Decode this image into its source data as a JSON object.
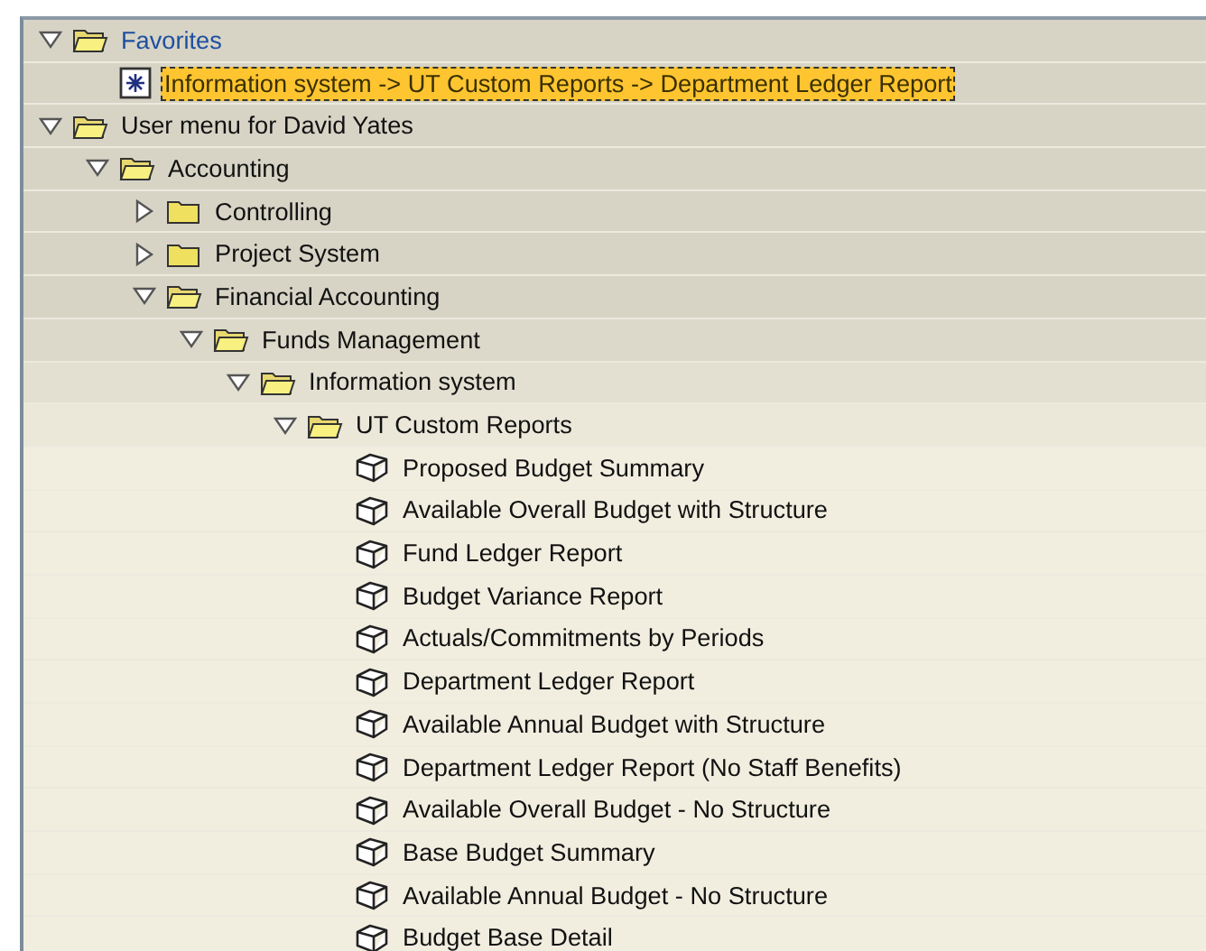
{
  "tree": [
    {
      "kind": "folder",
      "label": "Favorites",
      "expanded": true,
      "selected": false,
      "children": [
        {
          "kind": "favorite",
          "label": "Information system -> UT Custom Reports -> Department Ledger Report",
          "selected": true
        }
      ]
    },
    {
      "kind": "folder",
      "label": "User menu for David Yates",
      "expanded": true,
      "selected": false,
      "children": [
        {
          "kind": "folder",
          "label": "Accounting",
          "expanded": true,
          "selected": false,
          "children": [
            {
              "kind": "folder",
              "label": "Controlling",
              "expanded": false,
              "selected": false
            },
            {
              "kind": "folder",
              "label": "Project System",
              "expanded": false,
              "selected": false
            },
            {
              "kind": "folder",
              "label": "Financial Accounting",
              "expanded": true,
              "selected": false,
              "children": [
                {
                  "kind": "folder",
                  "label": "Funds Management",
                  "expanded": true,
                  "selected": false,
                  "children": [
                    {
                      "kind": "folder",
                      "label": "Information system",
                      "expanded": true,
                      "selected": false,
                      "children": [
                        {
                          "kind": "folder",
                          "label": "UT Custom Reports",
                          "expanded": true,
                          "selected": false,
                          "children": [
                            {
                              "kind": "report",
                              "label": "Proposed Budget Summary",
                              "selected": false
                            },
                            {
                              "kind": "report",
                              "label": "Available Overall Budget with Structure",
                              "selected": false
                            },
                            {
                              "kind": "report",
                              "label": "Fund Ledger Report",
                              "selected": false
                            },
                            {
                              "kind": "report",
                              "label": "Budget Variance Report",
                              "selected": false
                            },
                            {
                              "kind": "report",
                              "label": "Actuals/Commitments by Periods",
                              "selected": false
                            },
                            {
                              "kind": "report",
                              "label": "Department Ledger Report",
                              "selected": false
                            },
                            {
                              "kind": "report",
                              "label": "Available Annual Budget with Structure",
                              "selected": false
                            },
                            {
                              "kind": "report",
                              "label": "Department Ledger Report (No Staff Benefits)",
                              "selected": false
                            },
                            {
                              "kind": "report",
                              "label": "Available Overall Budget - No Structure",
                              "selected": false
                            },
                            {
                              "kind": "report",
                              "label": "Base Budget Summary",
                              "selected": false
                            },
                            {
                              "kind": "report",
                              "label": "Available Annual Budget - No Structure",
                              "selected": false
                            },
                            {
                              "kind": "report",
                              "label": "Budget Base Detail",
                              "selected": false
                            }
                          ]
                        }
                      ]
                    }
                  ]
                }
              ]
            }
          ]
        }
      ]
    }
  ]
}
